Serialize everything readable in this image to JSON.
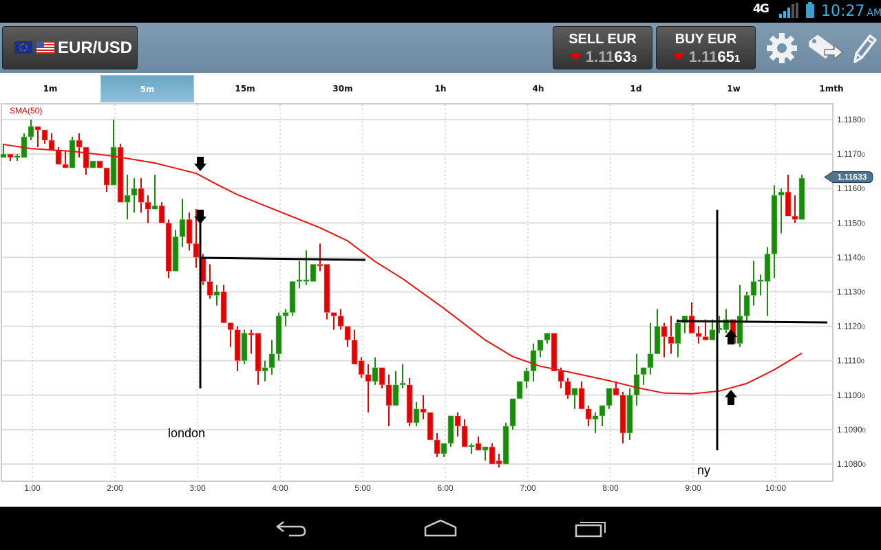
{
  "status_bar": {
    "network": "4G",
    "time": "10:27",
    "ampm": "AM",
    "icons": [
      "network-4g-icon",
      "signal-icon",
      "battery-icon"
    ]
  },
  "header": {
    "pair": "EUR/USD",
    "sell": {
      "label": "SELL EUR",
      "price_dim": "1.11",
      "price_big": "63",
      "price_small": "3",
      "direction": "down"
    },
    "buy": {
      "label": "BUY EUR",
      "price_dim": "1.11",
      "price_big": "65",
      "price_small": "1",
      "direction": "down"
    },
    "icons": [
      "settings-gear-icon",
      "tag-forward-icon",
      "pencil-icon"
    ]
  },
  "tabs": [
    {
      "label": "1m",
      "selected": false
    },
    {
      "label": "5m",
      "selected": true
    },
    {
      "label": "15m",
      "selected": false
    },
    {
      "label": "30m",
      "selected": false
    },
    {
      "label": "1h",
      "selected": false
    },
    {
      "label": "4h",
      "selected": false
    },
    {
      "label": "1d",
      "selected": false
    },
    {
      "label": "1w",
      "selected": false
    },
    {
      "label": "1mth",
      "selected": false
    }
  ],
  "colors": {
    "up": "#1a8c0a",
    "down": "#e60000",
    "sma": "#ee1111",
    "accent": "#6aa6c4",
    "header": "#7793a9"
  },
  "chart_data": {
    "type": "candlestick",
    "indicator_label": "SMA(50)",
    "current_price_label": "1.11633",
    "ylim": [
      1.1076,
      1.1185
    ],
    "y_ticks": [
      {
        "v": 1.118,
        "label": "1.1180",
        "sub": "0"
      },
      {
        "v": 1.117,
        "label": "1.1170",
        "sub": "0"
      },
      {
        "v": 1.116,
        "label": "1.1160",
        "sub": "0"
      },
      {
        "v": 1.115,
        "label": "1.1150",
        "sub": "0"
      },
      {
        "v": 1.114,
        "label": "1.1140",
        "sub": "0"
      },
      {
        "v": 1.113,
        "label": "1.1130",
        "sub": "0"
      },
      {
        "v": 1.112,
        "label": "1.1120",
        "sub": "0"
      },
      {
        "v": 1.111,
        "label": "1.1110",
        "sub": "0"
      },
      {
        "v": 1.11,
        "label": "1.1100",
        "sub": "0"
      },
      {
        "v": 1.109,
        "label": "1.1090",
        "sub": "0"
      },
      {
        "v": 1.108,
        "label": "1.1080",
        "sub": "0"
      }
    ],
    "x_ticks": [
      "1:00",
      "2:00",
      "3:00",
      "4:00",
      "5:00",
      "6:00",
      "7:00",
      "8:00",
      "9:00",
      "10:00"
    ],
    "grid": true,
    "candles_ohlc": [
      [
        1.1169,
        1.1173,
        1.1169,
        1.117
      ],
      [
        1.117,
        1.117,
        1.1168,
        1.1169
      ],
      [
        1.1169,
        1.117,
        1.1168,
        1.11695
      ],
      [
        1.1169,
        1.1176,
        1.1169,
        1.1175
      ],
      [
        1.1175,
        1.118,
        1.1174,
        1.1178
      ],
      [
        1.1178,
        1.1178,
        1.1172,
        1.1177
      ],
      [
        1.1177,
        1.1177,
        1.1173,
        1.1174
      ],
      [
        1.1174,
        1.1176,
        1.1171,
        1.1171
      ],
      [
        1.1171,
        1.1172,
        1.1167,
        1.1167
      ],
      [
        1.1167,
        1.1171,
        1.1166,
        1.1166
      ],
      [
        1.1166,
        1.1175,
        1.1166,
        1.1174
      ],
      [
        1.1174,
        1.1176,
        1.1169,
        1.1172
      ],
      [
        1.1172,
        1.1172,
        1.1164,
        1.1166
      ],
      [
        1.1166,
        1.1168,
        1.1166,
        1.1168
      ],
      [
        1.1168,
        1.1168,
        1.1166,
        1.1166
      ],
      [
        1.1166,
        1.1166,
        1.1159,
        1.1161
      ],
      [
        1.1161,
        1.118,
        1.1161,
        1.1172
      ],
      [
        1.1172,
        1.1173,
        1.1157,
        1.1156
      ],
      [
        1.1156,
        1.1164,
        1.1151,
        1.1158
      ],
      [
        1.1158,
        1.1163,
        1.1153,
        1.116
      ],
      [
        1.116,
        1.1163,
        1.1153,
        1.1156
      ],
      [
        1.1156,
        1.1158,
        1.115,
        1.1154
      ],
      [
        1.1154,
        1.1164,
        1.1154,
        1.1155
      ],
      [
        1.1155,
        1.1156,
        1.115,
        1.115
      ],
      [
        1.115,
        1.1151,
        1.1134,
        1.1136
      ],
      [
        1.1136,
        1.1148,
        1.1136,
        1.1146
      ],
      [
        1.1146,
        1.1157,
        1.1143,
        1.1151
      ],
      [
        1.1151,
        1.1153,
        1.1142,
        1.1144
      ],
      [
        1.1144,
        1.1154,
        1.1137,
        1.114
      ],
      [
        1.114,
        1.1141,
        1.1132,
        1.1133
      ],
      [
        1.1133,
        1.1138,
        1.1128,
        1.1129
      ],
      [
        1.1129,
        1.1132,
        1.1126,
        1.113
      ],
      [
        1.113,
        1.1132,
        1.1121,
        1.1121
      ],
      [
        1.1121,
        1.1121,
        1.1114,
        1.1119
      ],
      [
        1.1119,
        1.112,
        1.1107,
        1.111
      ],
      [
        1.111,
        1.1119,
        1.1109,
        1.1118
      ],
      [
        1.1118,
        1.1119,
        1.1112,
        1.11175
      ],
      [
        1.1118,
        1.1118,
        1.1103,
        1.1107
      ],
      [
        1.1107,
        1.111,
        1.1104,
        1.1108
      ],
      [
        1.1108,
        1.1116,
        1.1106,
        1.1112
      ],
      [
        1.1112,
        1.1124,
        1.111,
        1.1123
      ],
      [
        1.1123,
        1.1125,
        1.112,
        1.1124
      ],
      [
        1.1124,
        1.1133,
        1.1123,
        1.1133
      ],
      [
        1.1133,
        1.1139,
        1.1131,
        1.11335
      ],
      [
        1.1133,
        1.1142,
        1.1132,
        1.11335
      ],
      [
        1.1133,
        1.1138,
        1.1133,
        1.1138
      ],
      [
        1.1138,
        1.1144,
        1.1136,
        1.11375
      ],
      [
        1.1138,
        1.1138,
        1.1122,
        1.1124
      ],
      [
        1.1124,
        1.1124,
        1.1119,
        1.1123
      ],
      [
        1.1123,
        1.1125,
        1.1119,
        1.112
      ],
      [
        1.112,
        1.112,
        1.1114,
        1.1116
      ],
      [
        1.1116,
        1.1119,
        1.1109,
        1.1109
      ],
      [
        1.111,
        1.1111,
        1.1105,
        1.1106
      ],
      [
        1.1106,
        1.1109,
        1.1095,
        1.1104
      ],
      [
        1.1104,
        1.1111,
        1.1103,
        1.1108
      ],
      [
        1.1108,
        1.1108,
        1.1102,
        1.1103
      ],
      [
        1.1103,
        1.1106,
        1.1091,
        1.1097
      ],
      [
        1.1097,
        1.1107,
        1.1097,
        1.1103
      ],
      [
        1.1103,
        1.1109,
        1.1102,
        1.11035
      ],
      [
        1.1103,
        1.1105,
        1.1091,
        1.1092
      ],
      [
        1.1092,
        1.1098,
        1.1091,
        1.1096
      ],
      [
        1.1096,
        1.11,
        1.1093,
        1.1095
      ],
      [
        1.1095,
        1.1095,
        1.1087,
        1.1087
      ],
      [
        1.1087,
        1.1089,
        1.1082,
        1.1083
      ],
      [
        1.1083,
        1.1086,
        1.1082,
        1.1086
      ],
      [
        1.1086,
        1.1094,
        1.1085,
        1.1094
      ],
      [
        1.1094,
        1.1095,
        1.1088,
        1.1091
      ],
      [
        1.1091,
        1.1093,
        1.1085,
        1.1085
      ],
      [
        1.1085,
        1.1086,
        1.1083,
        1.10855
      ],
      [
        1.1086,
        1.1088,
        1.1084,
        1.1084
      ],
      [
        1.1084,
        1.1085,
        1.1081,
        1.1085
      ],
      [
        1.1085,
        1.1086,
        1.108,
        1.108
      ],
      [
        1.1081,
        1.1083,
        1.1079,
        1.108
      ],
      [
        1.108,
        1.1092,
        1.108,
        1.1091
      ],
      [
        1.1091,
        1.1091,
        1.109,
        1.1099
      ],
      [
        1.1099,
        1.1104,
        1.1099,
        1.1104
      ],
      [
        1.1104,
        1.1108,
        1.1102,
        1.1107
      ],
      [
        1.1107,
        1.1115,
        1.1104,
        1.1113
      ],
      [
        1.1113,
        1.1116,
        1.1111,
        1.1116
      ],
      [
        1.1116,
        1.1118,
        1.1115,
        1.1118
      ],
      [
        1.1118,
        1.1118,
        1.1107,
        1.1107
      ],
      [
        1.1107,
        1.1108,
        1.1102,
        1.1104
      ],
      [
        1.1104,
        1.1105,
        1.1099,
        1.11
      ],
      [
        1.11,
        1.1101,
        1.1096,
        1.1102
      ],
      [
        1.1102,
        1.1104,
        1.1096,
        1.1096
      ],
      [
        1.1096,
        1.1097,
        1.1091,
        1.1093
      ],
      [
        1.1093,
        1.1095,
        1.1089,
        1.1094
      ],
      [
        1.1094,
        1.1097,
        1.1091,
        1.1097
      ],
      [
        1.1097,
        1.1102,
        1.1096,
        1.1102
      ],
      [
        1.1102,
        1.1104,
        1.11,
        1.11
      ],
      [
        1.11,
        1.1101,
        1.1086,
        1.1089
      ],
      [
        1.1089,
        1.1102,
        1.1087,
        1.11
      ],
      [
        1.11,
        1.1112,
        1.1097,
        1.1106
      ],
      [
        1.1106,
        1.1108,
        1.1103,
        1.1108
      ],
      [
        1.1108,
        1.1121,
        1.1106,
        1.1112
      ],
      [
        1.1112,
        1.1125,
        1.1112,
        1.112
      ],
      [
        1.112,
        1.1121,
        1.1111,
        1.1117
      ],
      [
        1.1117,
        1.1123,
        1.1112,
        1.1115
      ],
      [
        1.1115,
        1.1122,
        1.1111,
        1.1121
      ],
      [
        1.1121,
        1.1123,
        1.1118,
        1.1123
      ],
      [
        1.1123,
        1.1127,
        1.1118,
        1.1118
      ],
      [
        1.1118,
        1.112,
        1.1115,
        1.1117
      ],
      [
        1.1117,
        1.1122,
        1.1116,
        1.1116
      ],
      [
        1.1116,
        1.1122,
        1.1116,
        1.1119
      ],
      [
        1.1119,
        1.1123,
        1.1118,
        1.11195
      ],
      [
        1.1119,
        1.1125,
        1.1118,
        1.1122
      ],
      [
        1.1122,
        1.1122,
        1.1115,
        1.1115
      ],
      [
        1.1115,
        1.1132,
        1.1114,
        1.1123
      ],
      [
        1.1123,
        1.113,
        1.1121,
        1.1129
      ],
      [
        1.1129,
        1.1139,
        1.1126,
        1.1133
      ],
      [
        1.1133,
        1.1135,
        1.1129,
        1.11335
      ],
      [
        1.1133,
        1.1143,
        1.1123,
        1.1141
      ],
      [
        1.1141,
        1.1161,
        1.1134,
        1.1158
      ],
      [
        1.1158,
        1.116,
        1.1147,
        1.1159
      ],
      [
        1.1159,
        1.1164,
        1.1152,
        1.1152
      ],
      [
        1.1152,
        1.1158,
        1.115,
        1.1151
      ],
      [
        1.1151,
        1.1164,
        1.1151,
        1.1163
      ]
    ],
    "sma_points": [
      [
        "0:40",
        1.11728
      ],
      [
        "1:00",
        1.11716
      ],
      [
        "1:30",
        1.11708
      ],
      [
        "2:00",
        1.11694
      ],
      [
        "2:30",
        1.11674
      ],
      [
        "3:00",
        1.11644
      ],
      [
        "3:15",
        1.11612
      ],
      [
        "3:30",
        1.11582
      ],
      [
        "4:00",
        1.11534
      ],
      [
        "4:30",
        1.11486
      ],
      [
        "4:50",
        1.11448
      ],
      [
        "5:10",
        1.11388
      ],
      [
        "5:30",
        1.11338
      ],
      [
        "6:00",
        1.11252
      ],
      [
        "6:30",
        1.1116
      ],
      [
        "6:50",
        1.11112
      ],
      [
        "7:10",
        1.11084
      ],
      [
        "7:30",
        1.11068
      ],
      [
        "8:00",
        1.11042
      ],
      [
        "8:20",
        1.11022
      ],
      [
        "8:40",
        1.11006
      ],
      [
        "9:00",
        1.11004
      ],
      [
        "9:20",
        1.11012
      ],
      [
        "9:40",
        1.11034
      ],
      [
        "10:00",
        1.11074
      ],
      [
        "10:20",
        1.11122
      ]
    ],
    "annotations": {
      "london": "london",
      "ny": "ny"
    }
  }
}
